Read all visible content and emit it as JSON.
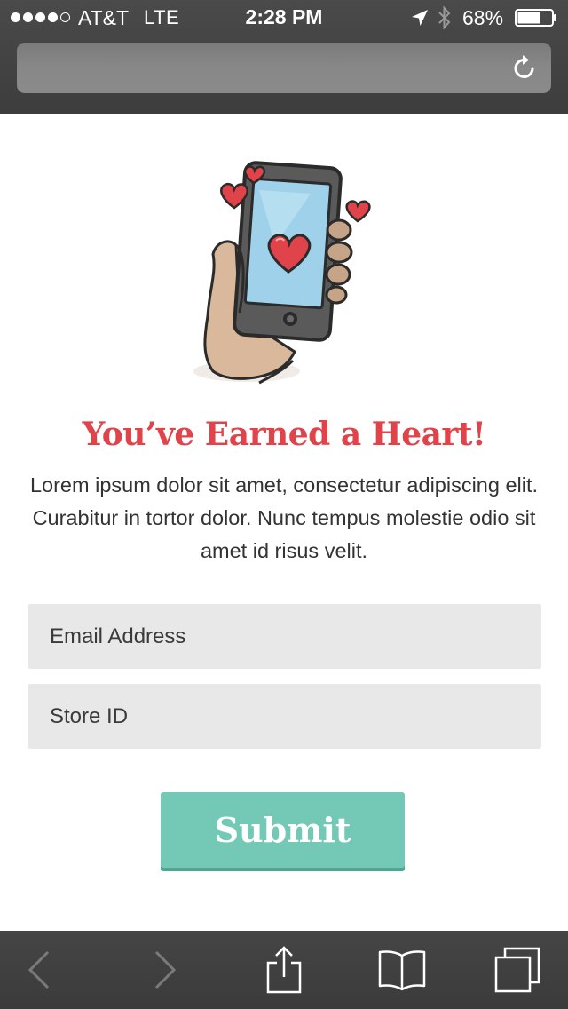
{
  "status_bar": {
    "carrier": "AT&T",
    "network": "LTE",
    "time": "2:28 PM",
    "battery_percent": "68%",
    "battery_level": 0.68,
    "signal_bars_filled": 4,
    "signal_bars_total": 5
  },
  "address_bar": {
    "value": "",
    "reload_icon": "reload-icon"
  },
  "main": {
    "illustration": "hand-holding-phone-with-hearts",
    "headline": "You’ve Earned a Heart!",
    "body": "Lorem ipsum dolor sit amet, consectetur adipiscing elit. Curabitur in tortor dolor. Nunc tempus molestie odio sit amet  id risus velit.",
    "form": {
      "email_placeholder": "Email Address",
      "store_id_placeholder": "Store ID",
      "submit_label": "Submit"
    }
  },
  "toolbar": {
    "icons": [
      "back-icon",
      "forward-icon",
      "share-icon",
      "bookmarks-icon",
      "tabs-icon"
    ]
  },
  "colors": {
    "headline": "#e0434a",
    "submit_button": "#74c8b6",
    "field_background": "#e8e8e8",
    "chrome": "#404040"
  }
}
